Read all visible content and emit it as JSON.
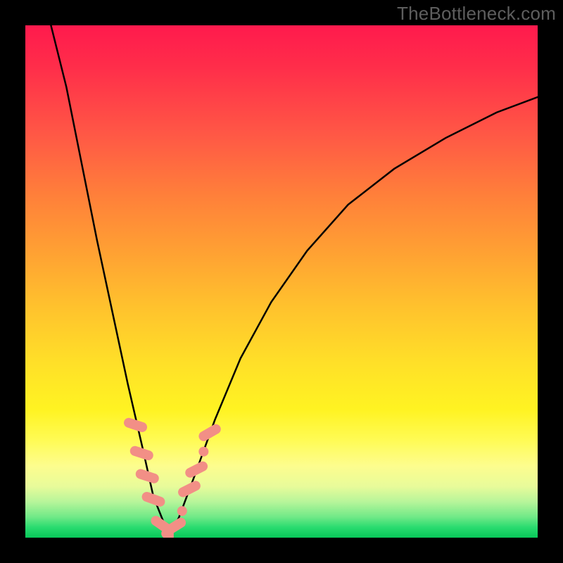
{
  "watermark": "TheBottleneck.com",
  "chart_data": {
    "type": "line",
    "title": "",
    "xlabel": "",
    "ylabel": "",
    "xlim": [
      0,
      100
    ],
    "ylim": [
      0,
      100
    ],
    "grid": false,
    "legend": false,
    "background_gradient": {
      "stops": [
        {
          "pos": 0,
          "color": "#ff1a4d"
        },
        {
          "pos": 0.5,
          "color": "#ffc22d"
        },
        {
          "pos": 0.8,
          "color": "#fffb55"
        },
        {
          "pos": 1.0,
          "color": "#08c95a"
        }
      ],
      "note": "Background hue maps to bottleneck severity; red=high, green=low"
    },
    "series": [
      {
        "name": "bottleneck-left",
        "x": [
          5,
          8,
          11,
          14,
          17,
          20,
          23,
          25,
          27,
          28
        ],
        "y": [
          100,
          88,
          73,
          58,
          44,
          30,
          17,
          8,
          3,
          0
        ],
        "stroke": "#000000"
      },
      {
        "name": "bottleneck-right",
        "x": [
          28,
          30,
          33,
          37,
          42,
          48,
          55,
          63,
          72,
          82,
          92,
          100
        ],
        "y": [
          0,
          4,
          12,
          23,
          35,
          46,
          56,
          65,
          72,
          78,
          83,
          86
        ],
        "stroke": "#000000"
      }
    ],
    "markers": [
      {
        "name": "marker-left-1",
        "x": 21.5,
        "y": 22,
        "angle": -72,
        "color": "#f28f86"
      },
      {
        "name": "marker-left-2",
        "x": 22.7,
        "y": 16.5,
        "angle": -72,
        "color": "#f28f86"
      },
      {
        "name": "marker-left-3",
        "x": 23.8,
        "y": 12,
        "angle": -72,
        "color": "#f28f86"
      },
      {
        "name": "marker-left-4",
        "x": 25.0,
        "y": 7.5,
        "angle": -70,
        "color": "#f28f86"
      },
      {
        "name": "marker-trough-l",
        "x": 26.6,
        "y": 2.5,
        "angle": -55,
        "color": "#f28f86"
      },
      {
        "name": "marker-trough-dot",
        "x": 27.5,
        "y": 0.8,
        "angle": 0,
        "color": "#f28f86",
        "shape": "dot"
      },
      {
        "name": "marker-right-0",
        "x": 29.2,
        "y": 2.2,
        "angle": 58,
        "color": "#f28f86"
      },
      {
        "name": "marker-right-dot",
        "x": 30.6,
        "y": 5.2,
        "angle": 0,
        "color": "#f28f86",
        "shape": "dot"
      },
      {
        "name": "marker-right-1",
        "x": 32.0,
        "y": 9.5,
        "angle": 63,
        "color": "#f28f86"
      },
      {
        "name": "marker-right-2",
        "x": 33.4,
        "y": 13.3,
        "angle": 63,
        "color": "#f28f86"
      },
      {
        "name": "marker-right-dot2",
        "x": 34.8,
        "y": 16.8,
        "angle": 0,
        "color": "#f28f86",
        "shape": "dot"
      },
      {
        "name": "marker-right-3",
        "x": 36.0,
        "y": 20.5,
        "angle": 60,
        "color": "#f28f86"
      },
      {
        "name": "marker-bottom",
        "x": 28.0,
        "y": 0.3,
        "angle": 0,
        "color": "#f28f86"
      }
    ]
  }
}
